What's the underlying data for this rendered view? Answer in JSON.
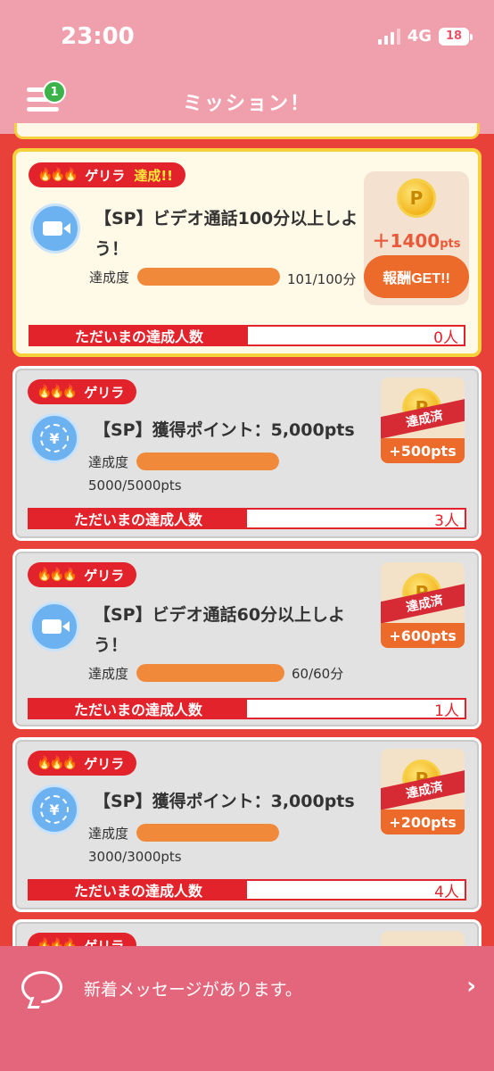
{
  "status_bar": {
    "time": "23:00",
    "network": "4G",
    "battery": "18"
  },
  "header": {
    "title": "ミッション！",
    "menu_badge": "1"
  },
  "missions": [
    {
      "tag": "ゲリラ",
      "tag_sub": "達成!!",
      "icon": "video-call-icon",
      "title": "【SP】ビデオ通話100分以上しよう！",
      "progress_label": "達成度",
      "progress_value": "101/100分",
      "progress": 1.0,
      "reward": "＋1400",
      "reward_unit": "pts",
      "button": "報酬GET!!",
      "count_label": "ただいまの達成人数",
      "count": "0人"
    },
    {
      "tag": "ゲリラ",
      "icon": "yen-coin-icon",
      "title": "【SP】獲得ポイント：5,000pts",
      "progress_label": "達成度",
      "progress_value": "5000/5000pts",
      "progress": 1.0,
      "ribbon": "達成済",
      "reward": "+500pts",
      "count_label": "ただいまの達成人数",
      "count": "3人"
    },
    {
      "tag": "ゲリラ",
      "icon": "video-call-icon",
      "title": "【SP】ビデオ通話60分以上しよう！",
      "progress_label": "達成度",
      "progress_value": "60/60分",
      "progress": 1.0,
      "ribbon": "達成済",
      "reward": "+600pts",
      "count_label": "ただいまの達成人数",
      "count": "1人"
    },
    {
      "tag": "ゲリラ",
      "icon": "yen-coin-icon",
      "title": "【SP】獲得ポイント：3,000pts",
      "progress_label": "達成度",
      "progress_value": "3000/3000pts",
      "progress": 1.0,
      "ribbon": "達成済",
      "reward": "+200pts",
      "count_label": "ただいまの達成人数",
      "count": "4人"
    },
    {
      "tag": "ゲリラ"
    }
  ],
  "coin_letter": "P",
  "banner": {
    "text": "新着メッセージがあります。",
    "arrow": "›"
  },
  "colors": {
    "header": "#f0a0ad",
    "background": "#e8413a",
    "accent_red": "#e3232b",
    "orange": "#f0893a",
    "banner": "#e3667c"
  }
}
